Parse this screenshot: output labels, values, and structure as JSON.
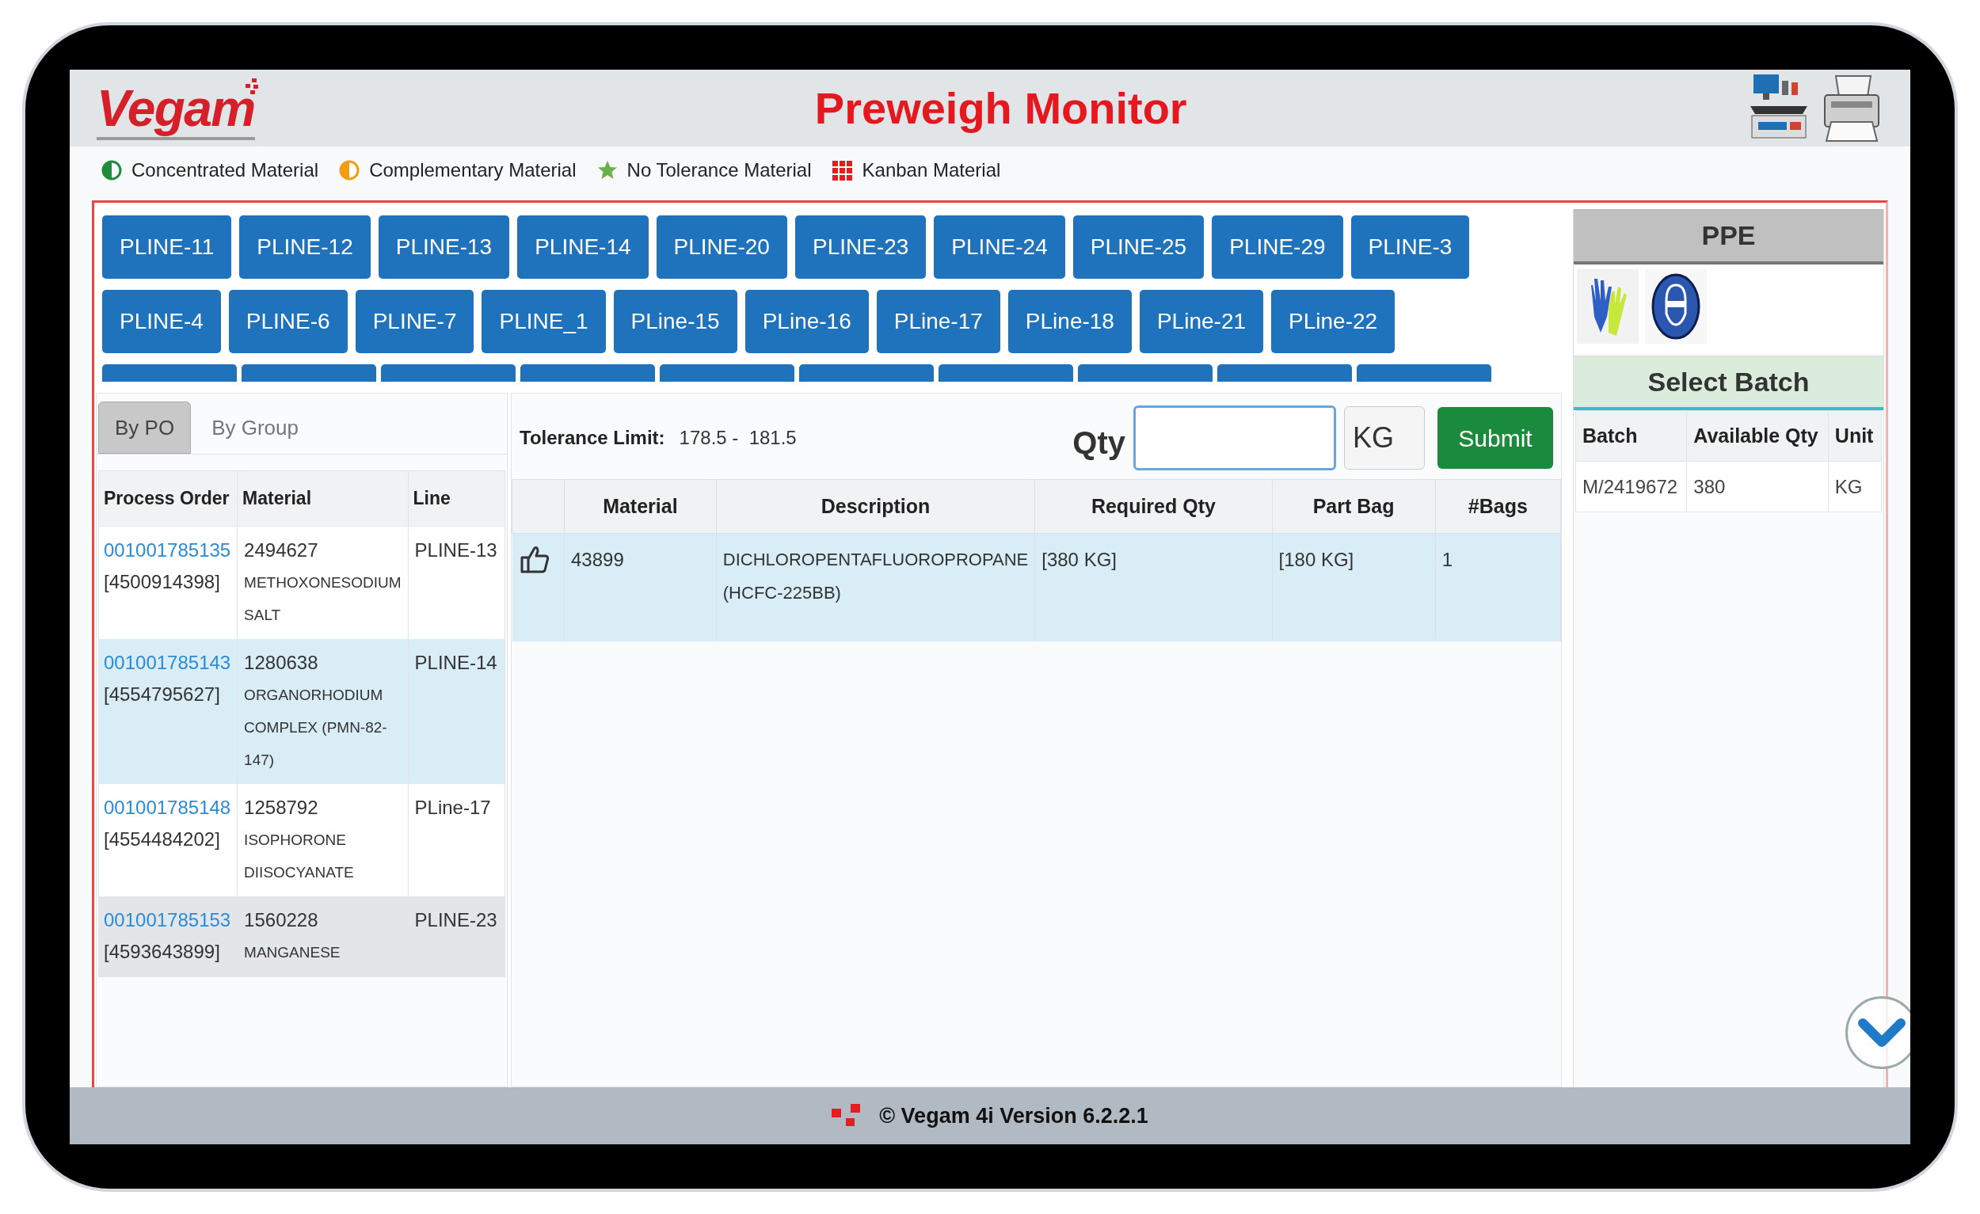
{
  "header": {
    "logo": "Vegam",
    "title": "Preweigh Monitor"
  },
  "legend": [
    {
      "kind": "half_circle",
      "color": "#1e8e3e",
      "label": "Concentrated Material"
    },
    {
      "kind": "half_circle",
      "color": "#f39c12",
      "label": "Complementary Material"
    },
    {
      "kind": "star",
      "color": "#6ab04c",
      "label": "No Tolerance Material"
    },
    {
      "kind": "grid",
      "color": "#e02020",
      "label": "Kanban Material"
    }
  ],
  "line_buttons": [
    [
      "PLINE-11",
      "PLINE-12",
      "PLINE-13",
      "PLINE-14",
      "PLINE-20",
      "PLINE-23",
      "PLINE-24",
      "PLINE-25",
      "PLINE-29",
      "PLINE-3"
    ],
    [
      "PLINE-4",
      "PLINE-6",
      "PLINE-7",
      "PLINE_1",
      "PLine-15",
      "PLine-16",
      "PLine-17",
      "PLine-18",
      "PLine-21",
      "PLine-22"
    ]
  ],
  "tabs": [
    {
      "label": "By PO",
      "selected": true
    },
    {
      "label": "By Group",
      "selected": false
    }
  ],
  "orders_table": {
    "columns": [
      "Process Order",
      "Material",
      "Line"
    ],
    "rows": [
      {
        "order": "001001785135",
        "ref": "[4500914398]",
        "material": "2494627",
        "name": "METHOXONESODIUM SALT",
        "line": "PLINE-13",
        "selected": false
      },
      {
        "order": "001001785143",
        "ref": "[4554795627]",
        "material": "1280638",
        "name": "ORGANORHODIUM COMPLEX (PMN-82-147)",
        "line": "PLINE-14",
        "selected": true
      },
      {
        "order": "001001785148",
        "ref": "[4554484202]",
        "material": "1258792",
        "name": "ISOPHORONE DIISOCYANATE",
        "line": "PLine-17",
        "selected": false
      },
      {
        "order": "001001785153",
        "ref": "[4593643899]",
        "material": "1560228",
        "name": "MANGANESE",
        "line": "PLINE-23",
        "selected": false
      }
    ]
  },
  "tolerance": {
    "label": "Tolerance Limit:",
    "value": "178.5 -  181.5"
  },
  "qty": {
    "label": "Qty",
    "unit": "KG",
    "submit": "Submit"
  },
  "materials_table": {
    "columns": [
      "Material",
      "Description",
      "Required Qty",
      "Part Bag",
      "#Bags"
    ],
    "rows": [
      {
        "material": "43899",
        "description": "DICHLOROPENTAFLUOROPROPANE (HCFC-225BB)",
        "required_qty": "[380 KG]",
        "part_bag": "[180 KG]",
        "bags": "1",
        "selected": true
      }
    ]
  },
  "ppe": {
    "title": "PPE"
  },
  "batch": {
    "title": "Select Batch",
    "columns": [
      "Batch",
      "Available Qty",
      "Unit"
    ],
    "rows": [
      {
        "batch": "M/2419672",
        "available_qty": "380",
        "unit": "KG"
      }
    ]
  },
  "footer": {
    "text": "© Vegam 4i Version 6.2.2.1"
  }
}
